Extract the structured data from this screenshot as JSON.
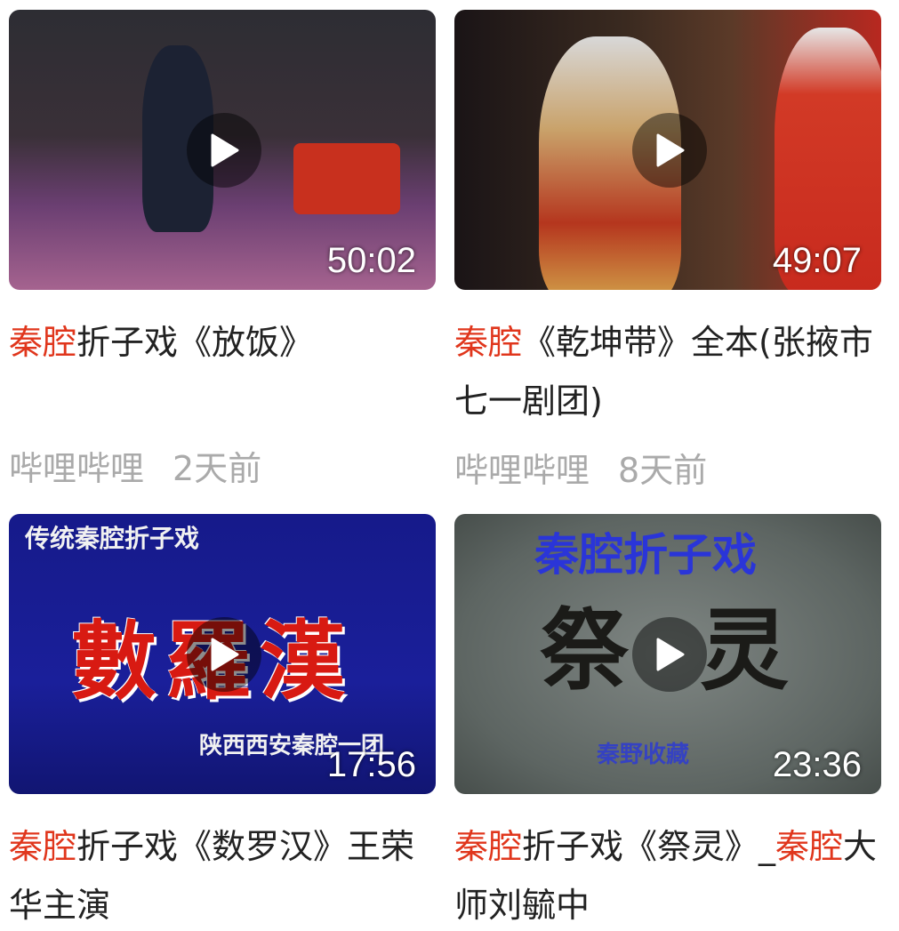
{
  "videos": [
    {
      "title_highlight": "秦腔",
      "title_rest": "折子戏《放饭》",
      "duration": "50:02",
      "source": "哔哩哔哩",
      "time": "2天前"
    },
    {
      "title_highlight": "秦腔",
      "title_rest": "《乾坤带》全本(张掖市七一剧团)",
      "duration": "49:07",
      "source": "哔哩哔哩",
      "time": "8天前"
    },
    {
      "title_highlight": "秦腔",
      "title_rest": "折子戏《数罗汉》王荣华主演",
      "duration": "17:56",
      "thumb_top": "传统秦腔折子戏",
      "thumb_main": "數羅漢",
      "thumb_bottom": "陕西西安秦腔一团"
    },
    {
      "title_highlight": "秦腔",
      "title_rest_1": "折子戏《祭灵》_",
      "title_highlight_2": "秦腔",
      "title_rest_2": "大师刘毓中",
      "duration": "23:36",
      "thumb_top": "秦腔折子戏",
      "thumb_main": "祭灵",
      "thumb_bottom": "秦野收藏"
    }
  ],
  "colors": {
    "highlight": "#e0361c",
    "title": "#222222",
    "meta": "#aaaaaa"
  },
  "icons": {
    "play": "play-icon"
  }
}
